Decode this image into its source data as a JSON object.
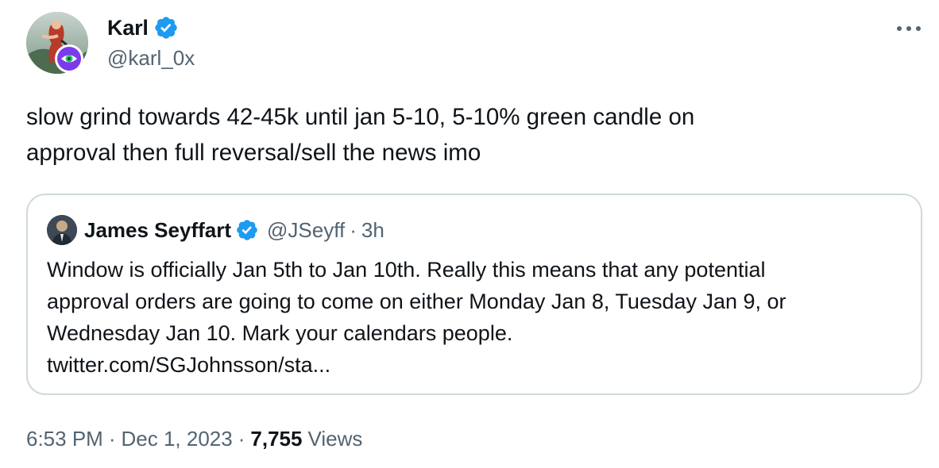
{
  "author": {
    "display_name": "Karl",
    "handle": "@karl_0x",
    "verified": true,
    "avatar_icon": "profile-photo-painting",
    "badge_icon": "eye-badge-icon"
  },
  "more_icon": "more-dots-icon",
  "tweet": {
    "text": "slow grind towards 42-45k until jan 5-10, 5-10% green candle on\napproval then full reversal/sell the news imo"
  },
  "quote": {
    "display_name": "James Seyffart",
    "handle": "@JSeyff",
    "separator": "·",
    "time": "3h",
    "verified": true,
    "lines": [
      "Window is officially Jan 5th to Jan 10th. Really this means that any potential",
      "approval orders are going to come on either Monday Jan 8, Tuesday Jan 9, or",
      "Wednesday Jan 10. Mark your calendars people.",
      "twitter.com/SGJohnsson/sta..."
    ]
  },
  "meta": {
    "time": "6:53 PM",
    "separator": "·",
    "date": "Dec 1, 2023",
    "views_count": "7,755",
    "views_label": "Views"
  },
  "colors": {
    "text": "#0f1419",
    "secondary": "#536471",
    "verified_blue": "#1d9bf0",
    "border": "#cfd9de",
    "badge_purple": "#7c3aed"
  }
}
